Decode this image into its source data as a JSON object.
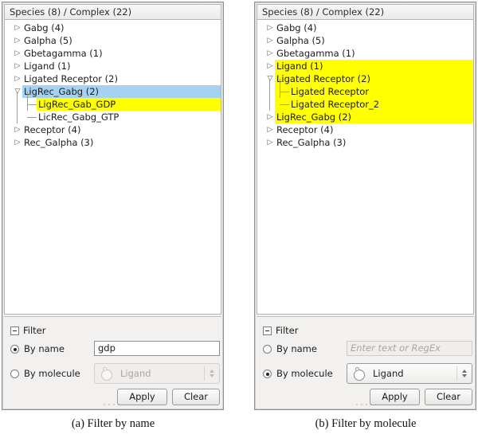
{
  "panels": [
    {
      "id": "filter-by-name",
      "tree_header": "Species (8) / Complex (22)",
      "rows": [
        {
          "label": "Gabg (4)",
          "arrow": "closed",
          "state": "normal",
          "level": 0
        },
        {
          "label": "Galpha (5)",
          "arrow": "closed",
          "state": "normal",
          "level": 0
        },
        {
          "label": "Gbetagamma (1)",
          "arrow": "closed",
          "state": "normal",
          "level": 0
        },
        {
          "label": "Ligand (1)",
          "arrow": "closed",
          "state": "normal",
          "level": 0
        },
        {
          "label": "Ligated Receptor (2)",
          "arrow": "closed",
          "state": "normal",
          "level": 0
        },
        {
          "label": "LigRec_Gabg (2)",
          "arrow": "open",
          "state": "selected",
          "level": 0
        },
        {
          "label": "LigRec_Gab_GDP",
          "arrow": "none",
          "state": "highlight",
          "level": 1
        },
        {
          "label": "LicRec_Gabg_GTP",
          "arrow": "none",
          "state": "normal",
          "level": 1
        },
        {
          "label": "Receptor (4)",
          "arrow": "closed",
          "state": "normal",
          "level": 0
        },
        {
          "label": "Rec_Galpha (3)",
          "arrow": "closed",
          "state": "normal",
          "level": 0
        }
      ],
      "filter": {
        "title": "Filter",
        "by_name_label": "By name",
        "by_molecule_label": "By molecule",
        "selected_mode": "by_name",
        "name_value": "gdp",
        "name_placeholder": "Enter text or RegEx",
        "molecule_value": "Ligand",
        "apply_label": "Apply",
        "clear_label": "Clear"
      },
      "caption": "(a) Filter by name"
    },
    {
      "id": "filter-by-molecule",
      "tree_header": "Species (8) / Complex (22)",
      "rows": [
        {
          "label": "Gabg (4)",
          "arrow": "closed",
          "state": "normal",
          "level": 0
        },
        {
          "label": "Galpha (5)",
          "arrow": "closed",
          "state": "normal",
          "level": 0
        },
        {
          "label": "Gbetagamma (1)",
          "arrow": "closed",
          "state": "normal",
          "level": 0
        },
        {
          "label": "Ligand (1)",
          "arrow": "closed",
          "state": "highlight",
          "level": 0
        },
        {
          "label": "Ligated Receptor (2)",
          "arrow": "open",
          "state": "highlight",
          "level": 0
        },
        {
          "label": "Ligated Receptor",
          "arrow": "none",
          "state": "highlight-full",
          "level": 1
        },
        {
          "label": "Ligated Receptor_2",
          "arrow": "none",
          "state": "highlight-full",
          "level": 1
        },
        {
          "label": "LigRec_Gabg (2)",
          "arrow": "closed",
          "state": "highlight",
          "level": 0
        },
        {
          "label": "Receptor (4)",
          "arrow": "closed",
          "state": "normal",
          "level": 0
        },
        {
          "label": "Rec_Galpha (3)",
          "arrow": "closed",
          "state": "normal",
          "level": 0
        }
      ],
      "filter": {
        "title": "Filter",
        "by_name_label": "By name",
        "by_molecule_label": "By molecule",
        "selected_mode": "by_molecule",
        "name_value": "",
        "name_placeholder": "Enter text or RegEx",
        "molecule_value": "Ligand",
        "apply_label": "Apply",
        "clear_label": "Clear"
      },
      "caption": "(b) Filter by molecule"
    }
  ],
  "colors": {
    "selection_blue": "#a5d2f0",
    "highlight_yellow": "#ffff00",
    "panel_grey": "#f2f1f0",
    "tree_white": "#ffffff",
    "border_grey": "#8f8f8f"
  }
}
